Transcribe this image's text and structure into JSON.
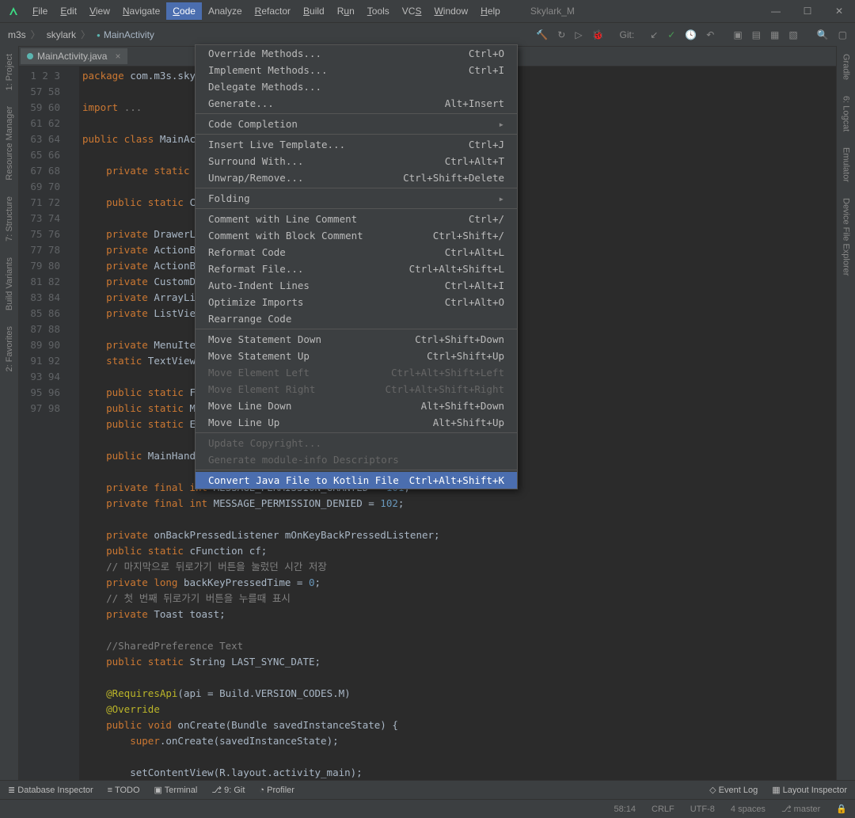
{
  "titlebar": {
    "project_name": "Skylark_M"
  },
  "menu": {
    "items": [
      {
        "label": "File",
        "u": 0
      },
      {
        "label": "Edit",
        "u": 0
      },
      {
        "label": "View",
        "u": 0
      },
      {
        "label": "Navigate",
        "u": 0
      },
      {
        "label": "Code",
        "u": 0,
        "active": true
      },
      {
        "label": "Analyze",
        "u": -1
      },
      {
        "label": "Refactor",
        "u": 0
      },
      {
        "label": "Build",
        "u": 0
      },
      {
        "label": "Run",
        "u": 1
      },
      {
        "label": "Tools",
        "u": 0
      },
      {
        "label": "VCS",
        "u": 2
      },
      {
        "label": "Window",
        "u": 0
      },
      {
        "label": "Help",
        "u": 0
      }
    ]
  },
  "breadcrumbs": [
    "m3s",
    "skylark",
    "MainActivity"
  ],
  "nav": {
    "git": "Git:"
  },
  "tab": {
    "file": "MainActivity.java"
  },
  "left_tabs": [
    "1: Project",
    "Resource Manager",
    "7: Structure",
    "Build Variants",
    "2: Favorites"
  ],
  "right_tabs": [
    "Gradle",
    "6: Logcat",
    "Emulator",
    "Device File Explorer"
  ],
  "dropdown": [
    {
      "label": "Override Methods...",
      "sc": "Ctrl+O"
    },
    {
      "label": "Implement Methods...",
      "sc": "Ctrl+I"
    },
    {
      "label": "Delegate Methods..."
    },
    {
      "label": "Generate...",
      "sc": "Alt+Insert"
    },
    {
      "sep": true
    },
    {
      "label": "Code Completion",
      "sub": true
    },
    {
      "sep": true
    },
    {
      "label": "Insert Live Template...",
      "sc": "Ctrl+J"
    },
    {
      "label": "Surround With...",
      "sc": "Ctrl+Alt+T"
    },
    {
      "label": "Unwrap/Remove...",
      "sc": "Ctrl+Shift+Delete"
    },
    {
      "sep": true
    },
    {
      "label": "Folding",
      "sub": true
    },
    {
      "sep": true
    },
    {
      "label": "Comment with Line Comment",
      "sc": "Ctrl+/"
    },
    {
      "label": "Comment with Block Comment",
      "sc": "Ctrl+Shift+/"
    },
    {
      "label": "Reformat Code",
      "sc": "Ctrl+Alt+L"
    },
    {
      "label": "Reformat File...",
      "sc": "Ctrl+Alt+Shift+L"
    },
    {
      "label": "Auto-Indent Lines",
      "sc": "Ctrl+Alt+I"
    },
    {
      "label": "Optimize Imports",
      "sc": "Ctrl+Alt+O"
    },
    {
      "label": "Rearrange Code"
    },
    {
      "sep": true
    },
    {
      "label": "Move Statement Down",
      "sc": "Ctrl+Shift+Down"
    },
    {
      "label": "Move Statement Up",
      "sc": "Ctrl+Shift+Up"
    },
    {
      "label": "Move Element Left",
      "sc": "Ctrl+Alt+Shift+Left",
      "disabled": true
    },
    {
      "label": "Move Element Right",
      "sc": "Ctrl+Alt+Shift+Right",
      "disabled": true
    },
    {
      "label": "Move Line Down",
      "sc": "Alt+Shift+Down"
    },
    {
      "label": "Move Line Up",
      "sc": "Alt+Shift+Up"
    },
    {
      "sep": true
    },
    {
      "label": "Update Copyright...",
      "disabled": true
    },
    {
      "label": "Generate module-info Descriptors",
      "disabled": true
    },
    {
      "sep": true
    },
    {
      "label": "Convert Java File to Kotlin File",
      "sc": "Ctrl+Alt+Shift+K",
      "hl": true
    }
  ],
  "code_lines": [
    {
      "n": 1,
      "t": "<span class='kw'>package</span> com.m3s.sky"
    },
    {
      "n": 2,
      "t": ""
    },
    {
      "n": 3,
      "t": "<span class='kw'>import</span> <span class='fold-box'>...</span>"
    },
    {
      "n": 57,
      "t": ""
    },
    {
      "n": 58,
      "t": "<span class='kw'>public class</span> MainAc"
    },
    {
      "n": 59,
      "t": ""
    },
    {
      "n": 60,
      "t": "    <span class='kw'>private static</span>"
    },
    {
      "n": 61,
      "t": ""
    },
    {
      "n": 62,
      "t": "    <span class='kw'>public static</span> C"
    },
    {
      "n": 63,
      "t": ""
    },
    {
      "n": 64,
      "t": "    <span class='kw'>private</span> DrawerL"
    },
    {
      "n": 65,
      "t": "    <span class='kw'>private</span> ActionB"
    },
    {
      "n": 66,
      "t": "    <span class='kw'>private</span> ActionB"
    },
    {
      "n": 67,
      "t": "    <span class='kw'>private</span> CustomD"
    },
    {
      "n": 68,
      "t": "    <span class='kw'>private</span> ArrayLi"
    },
    {
      "n": 69,
      "t": "    <span class='kw'>private</span> ListVie"
    },
    {
      "n": 70,
      "t": ""
    },
    {
      "n": 71,
      "t": "    <span class='kw'>private</span> MenuIte"
    },
    {
      "n": 72,
      "t": "    <span class='kw'>static</span> TextView"
    },
    {
      "n": 73,
      "t": ""
    },
    {
      "n": 74,
      "t": "    <span class='kw'>public static</span> F"
    },
    {
      "n": 75,
      "t": "    <span class='kw'>public static</span> M"
    },
    {
      "n": 76,
      "t": "    <span class='kw'>public static</span> Employee loginUserEntity;"
    },
    {
      "n": 77,
      "t": ""
    },
    {
      "n": 78,
      "t": "    <span class='kw'>public</span> MainHandler mainHandler = <span class='kw'>new</span> MainHandler();"
    },
    {
      "n": 79,
      "t": ""
    },
    {
      "n": 80,
      "t": "    <span class='kw'>private final int</span> MESSAGE_PERMISSION_GRANTED = <span class='num'>101</span>;"
    },
    {
      "n": 81,
      "t": "    <span class='kw'>private final int</span> MESSAGE_PERMISSION_DENIED = <span class='num'>102</span>;"
    },
    {
      "n": 82,
      "t": ""
    },
    {
      "n": 83,
      "t": "    <span class='kw'>private</span> onBackPressedListener mOnKeyBackPressedListener;"
    },
    {
      "n": 84,
      "t": "    <span class='kw'>public static</span> cFunction cf;"
    },
    {
      "n": 85,
      "t": "    <span class='com'>// 마지막으로 뒤로가기 버튼을 눌렀던 시간 저장</span>"
    },
    {
      "n": 86,
      "t": "    <span class='kw'>private long</span> backKeyPressedTime = <span class='num'>0</span>;"
    },
    {
      "n": 87,
      "t": "    <span class='com'>// 첫 번째 뒤로가기 버튼을 누를때 표시</span>"
    },
    {
      "n": 88,
      "t": "    <span class='kw'>private</span> Toast toast;"
    },
    {
      "n": 89,
      "t": ""
    },
    {
      "n": 90,
      "t": "    <span class='com'>//SharedPreference Text</span>"
    },
    {
      "n": 91,
      "t": "    <span class='kw'>public static</span> String LAST_SYNC_DATE;"
    },
    {
      "n": 92,
      "t": ""
    },
    {
      "n": 93,
      "t": "    <span class='ann'>@RequiresApi</span>(api = Build.VERSION_CODES.M)"
    },
    {
      "n": 94,
      "t": "    <span class='ann'>@Override</span>"
    },
    {
      "n": 95,
      "t": "    <span class='kw'>public void</span> onCreate(Bundle savedInstanceState) {"
    },
    {
      "n": 96,
      "t": "        <span class='kw'>super</span>.onCreate(savedInstanceState);"
    },
    {
      "n": 97,
      "t": ""
    },
    {
      "n": 98,
      "t": "        setContentView(R.layout.activity_main);"
    }
  ],
  "tool_windows": {
    "db": "Database Inspector",
    "todo": "TODO",
    "term": "Terminal",
    "git": "9: Git",
    "prof": "Profiler",
    "event": "Event Log",
    "layout": "Layout Inspector"
  },
  "status": {
    "pos": "58:14",
    "crlf": "CRLF",
    "enc": "UTF-8",
    "indent": "4 spaces",
    "branch": "master"
  }
}
